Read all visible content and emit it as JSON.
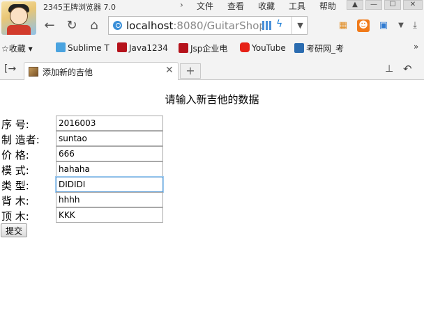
{
  "browser": {
    "app_title": "2345王牌浏览器 7.0",
    "menu": [
      "文件",
      "查看",
      "收藏",
      "工具",
      "帮助"
    ],
    "window_buttons": [
      "▲",
      "—",
      "☐",
      "✕"
    ],
    "url_host": "localhost",
    "url_rest": ":8080/GuitarShop",
    "bookmarks_label": "收藏",
    "bookmarks": [
      {
        "label": "Sublime T",
        "icon": "sublime-icon",
        "color": "#4aa3df"
      },
      {
        "label": "Java1234",
        "icon": "java1234-icon",
        "color": "#b5121b"
      },
      {
        "label": "Jsp企业电",
        "icon": "jsp-icon",
        "color": "#b5121b"
      },
      {
        "label": "YouTube",
        "icon": "youtube-icon",
        "color": "#e62117"
      },
      {
        "label": "考研网_考",
        "icon": "kaoyan-icon",
        "color": "#2b6cb0"
      }
    ],
    "more_bookmarks": "»",
    "tab_title": "添加新的吉他",
    "new_tab": "+"
  },
  "page": {
    "heading": "请输入新吉他的数据",
    "fields": [
      {
        "label": "序    号:",
        "value": "2016003"
      },
      {
        "label": "制  造者:",
        "value": "suntao"
      },
      {
        "label": "价    格:",
        "value": "666"
      },
      {
        "label": "模    式:",
        "value": "hahaha"
      },
      {
        "label": "类    型:",
        "value": "DIDIDI"
      },
      {
        "label": "背    木:",
        "value": "hhhh"
      },
      {
        "label": "顶    木:",
        "value": "KKK"
      }
    ],
    "submit_label": "提交"
  }
}
